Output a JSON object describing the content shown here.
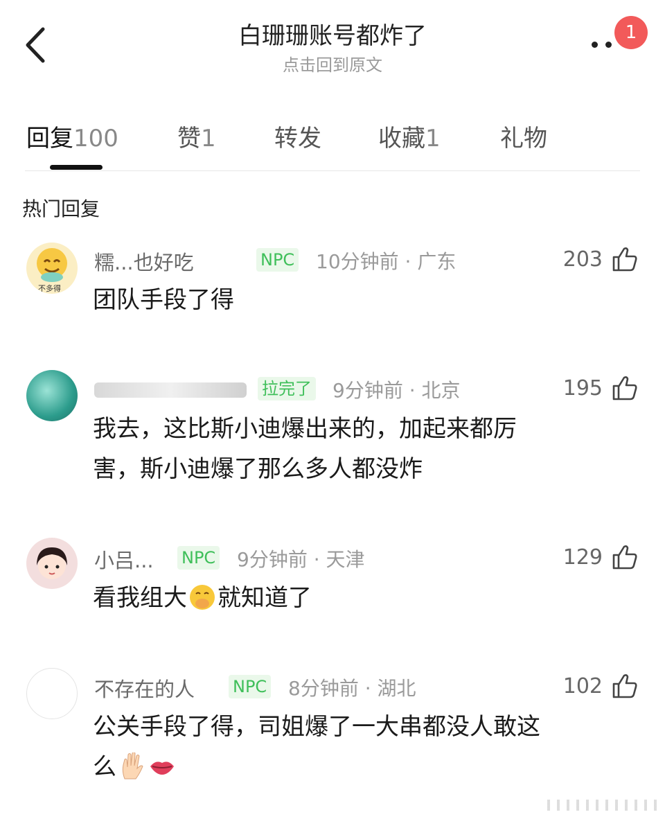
{
  "header": {
    "title": "白珊珊账号都炸了",
    "subtitle": "点击回到原文",
    "notification_count": "1"
  },
  "tabs": [
    {
      "label": "回复",
      "count": "100",
      "active": true
    },
    {
      "label": "赞",
      "count": "1",
      "active": false
    },
    {
      "label": "转发",
      "count": "",
      "active": false
    },
    {
      "label": "收藏",
      "count": "1",
      "active": false
    },
    {
      "label": "礼物",
      "count": "",
      "active": false
    }
  ],
  "section": {
    "label": "热门回复"
  },
  "comments": [
    {
      "name": "糯...也好吃",
      "badge": "NPC",
      "time": "10分钟前",
      "location": "广东",
      "likes": "203",
      "text_lines": [
        "团队手段了得"
      ]
    },
    {
      "name": "",
      "badge": "拉完了",
      "time": "9分钟前",
      "location": "北京",
      "likes": "195",
      "text_lines": [
        "我去，这比斯小迪爆出来的，加起来都厉",
        "害，斯小迪爆了那么多人都没炸"
      ]
    },
    {
      "name": "小吕...",
      "badge": "NPC",
      "time": "9分钟前",
      "location": "天津",
      "likes": "129",
      "text_before": "看我组大",
      "text_after": "就知道了",
      "emoji": "hand-over-mouth-emoji"
    },
    {
      "name": "不存在的人",
      "badge": "NPC",
      "time": "8分钟前",
      "location": "湖北",
      "likes": "102",
      "text_lines": [
        "公关手段了得，司姐爆了一大串都没人敢这",
        "么"
      ],
      "emojis": [
        "raised-hand-emoji",
        "lips-emoji"
      ]
    }
  ],
  "colors": {
    "accent_badge_text": "#3fbf5a",
    "accent_badge_bg": "#eaf8ea",
    "notification": "#f25a5a",
    "meta_text": "#9a9a9a"
  }
}
